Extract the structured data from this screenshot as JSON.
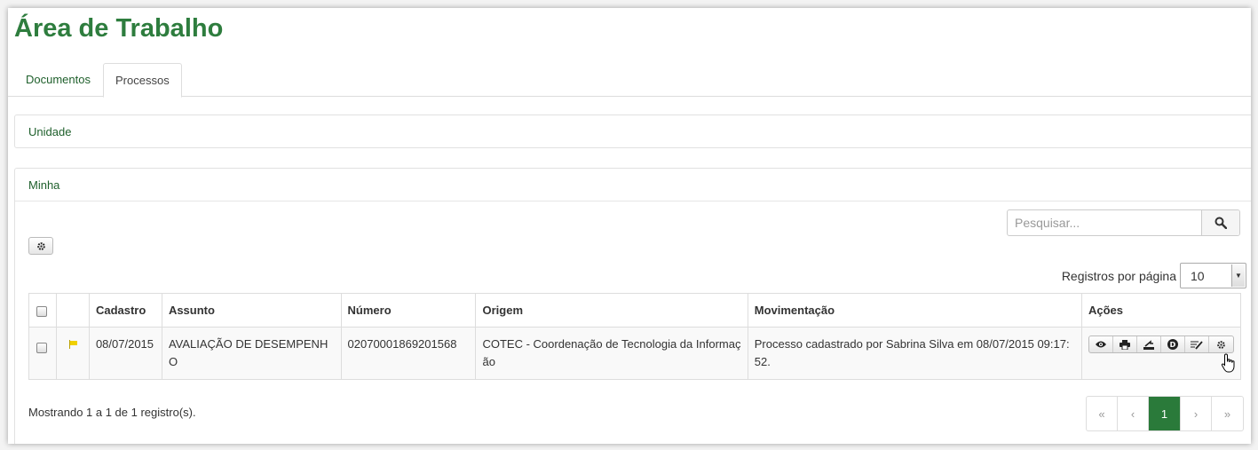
{
  "page": {
    "title": "Área de Trabalho"
  },
  "tabs": [
    {
      "label": "Documentos",
      "active": false
    },
    {
      "label": "Processos",
      "active": true
    }
  ],
  "panels": {
    "unidade": {
      "heading": "Unidade"
    },
    "minha": {
      "heading": "Minha"
    }
  },
  "search": {
    "placeholder": "Pesquisar...",
    "value": "",
    "icon": "search-icon"
  },
  "toolbar": {
    "settings_icon": "gear-icon"
  },
  "per_page": {
    "label": "Registros por página",
    "value": "10"
  },
  "table": {
    "columns": [
      "Cadastro",
      "Assunto",
      "Número",
      "Origem",
      "Movimentação",
      "Ações"
    ],
    "rows": [
      {
        "flag_color": "#f0d000",
        "cadastro": "08/07/2015",
        "assunto": "AVALIAÇÃO DE DESEMPENHO",
        "numero": "02070001869201568",
        "origem": "COTEC - Coordenação de Tecnologia da Informação",
        "movimentacao": "Processo cadastrado por Sabrina Silva em 08/07/2015 09:17:52.",
        "actions": [
          "eye-icon",
          "print-icon",
          "send-icon",
          "d-icon",
          "edit-icon",
          "gear-icon"
        ]
      }
    ]
  },
  "footer": {
    "summary": "Mostrando 1 a 1 de 1 registro(s)."
  },
  "pagination": {
    "first": "«",
    "prev": "‹",
    "current": "1",
    "next": "›",
    "last": "»"
  },
  "colors": {
    "brand": "#2e7d3e",
    "active_page": "#2a7a3a",
    "link": "#1e5f2b"
  }
}
